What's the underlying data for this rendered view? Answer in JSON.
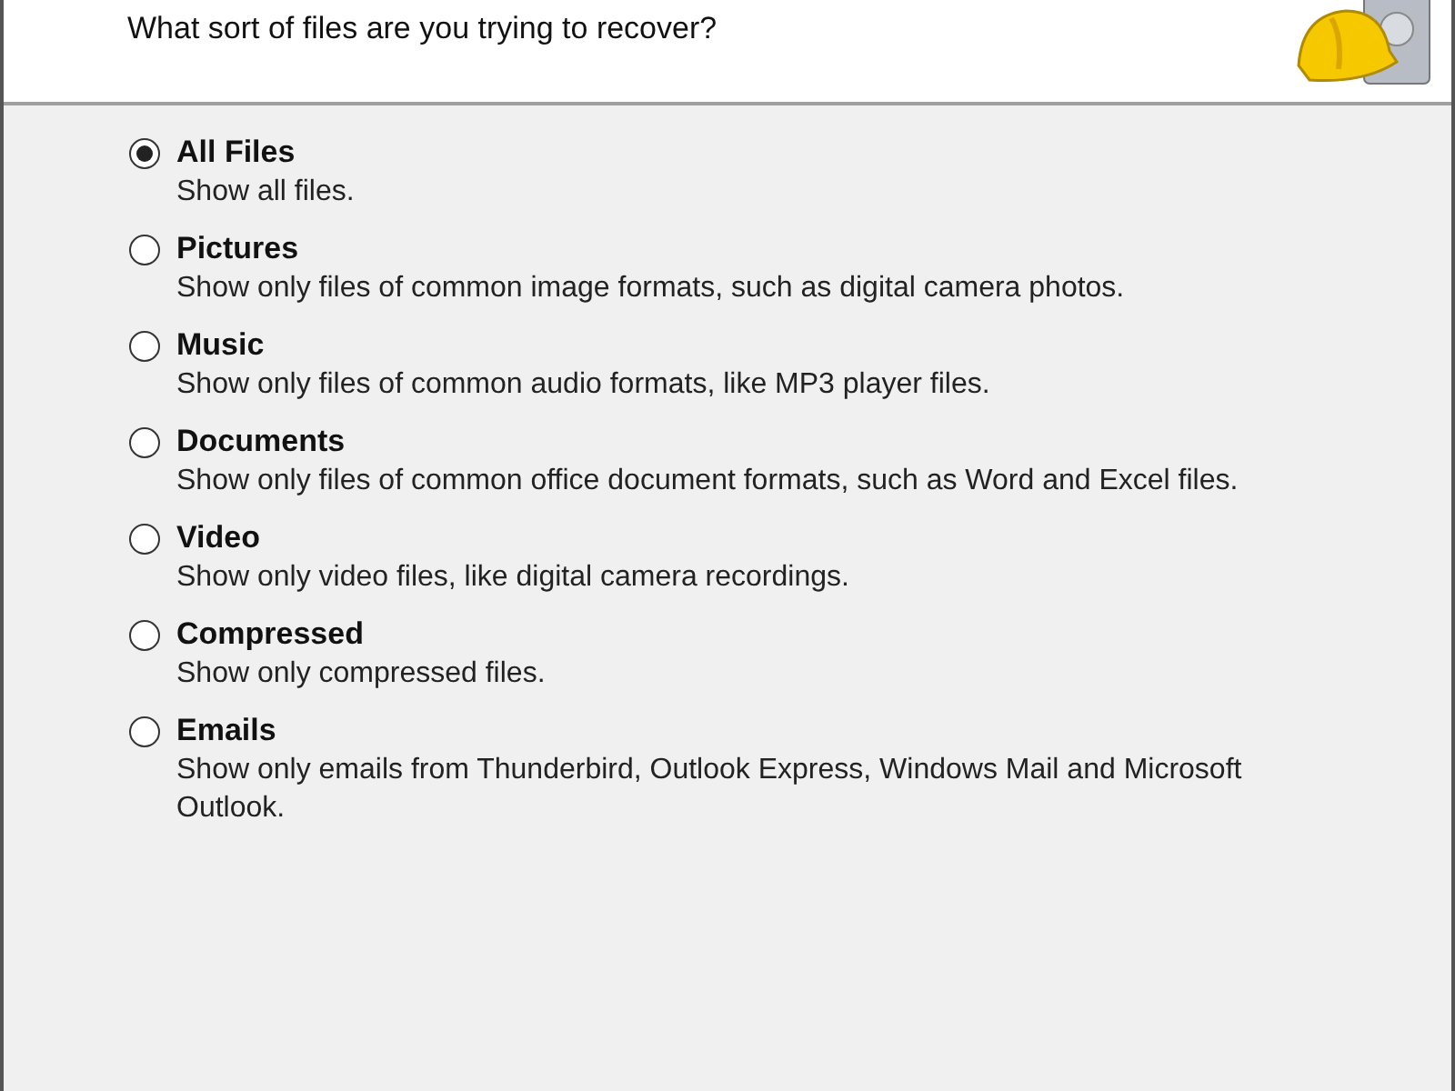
{
  "header": {
    "subtitle": "What sort of files are you trying to recover?"
  },
  "options": [
    {
      "label": "All Files",
      "description": "Show all files.",
      "selected": true
    },
    {
      "label": "Pictures",
      "description": "Show only files of common image formats, such as digital camera photos.",
      "selected": false
    },
    {
      "label": "Music",
      "description": "Show only files of common audio formats, like MP3 player files.",
      "selected": false
    },
    {
      "label": "Documents",
      "description": "Show only files of common office document formats, such as Word and Excel files.",
      "selected": false
    },
    {
      "label": "Video",
      "description": "Show only video files, like digital camera recordings.",
      "selected": false
    },
    {
      "label": "Compressed",
      "description": "Show only compressed files.",
      "selected": false
    },
    {
      "label": "Emails",
      "description": "Show only emails from Thunderbird, Outlook Express, Windows Mail and Microsoft Outlook.",
      "selected": false
    }
  ]
}
